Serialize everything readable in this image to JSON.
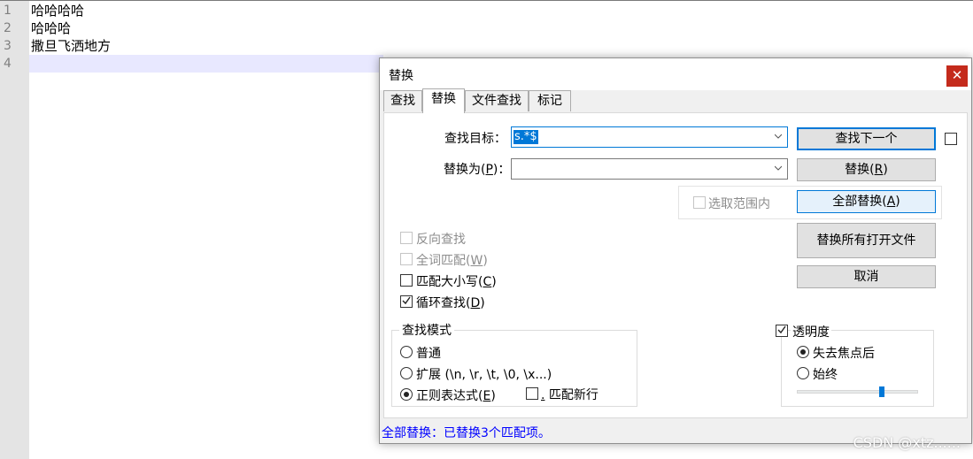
{
  "editor": {
    "lines": [
      {
        "num": "1",
        "text": "哈哈哈哈"
      },
      {
        "num": "2",
        "text": "哈哈哈"
      },
      {
        "num": "3",
        "text": "撒旦飞洒地方"
      },
      {
        "num": "4",
        "text": ""
      }
    ]
  },
  "dialog": {
    "title": "替换",
    "close_label": "✕",
    "tabs": [
      "查找",
      "替换",
      "文件查找",
      "标记"
    ],
    "active_tab": "替换",
    "find": {
      "label": "查找目标",
      "hotkey_suffix": "：",
      "value": "s.*$"
    },
    "replace": {
      "label_pre": "替换为(",
      "hotkey": "P",
      "label_post": ")：",
      "value": ""
    },
    "buttons": {
      "find_next": "查找下一个",
      "replace_pre": "替换(",
      "replace_key": "R",
      "replace_post": ")",
      "replace_all_pre": "全部替换(",
      "replace_all_key": "A",
      "replace_all_post": ")",
      "replace_all_open": "替换所有打开文件",
      "cancel": "取消"
    },
    "in_selection": {
      "label": "选取范围内",
      "checked": false,
      "enabled": false
    },
    "options": {
      "backward": {
        "label": "反向查找",
        "checked": false,
        "enabled": false
      },
      "whole_word": {
        "label_pre": "全词匹配(",
        "key": "W",
        "label_post": ")",
        "checked": false,
        "enabled": false
      },
      "match_case": {
        "label_pre": "匹配大小写(",
        "key": "C",
        "label_post": ")",
        "checked": false
      },
      "wrap": {
        "label_pre": "循环查找(",
        "key": "D",
        "label_post": ")",
        "checked": true
      }
    },
    "search_mode": {
      "title": "查找模式",
      "normal": "普通",
      "extended": "扩展 (\\n, \\r, \\t, \\0, \\x...)",
      "regex_pre": "正则表达式(",
      "regex_key": "E",
      "regex_post": ")",
      "selected": "regex",
      "dot_newline_key": ".",
      "dot_newline_label": " 匹配新行",
      "dot_newline_checked": false
    },
    "transparency": {
      "label": "透明度",
      "checked": true,
      "on_lose_focus": "失去焦点后",
      "always": "始终",
      "selected": "on_lose_focus",
      "level": 0.7
    },
    "status": "全部替换：已替换3个匹配项。"
  },
  "watermark": "CSDN @xtz......"
}
